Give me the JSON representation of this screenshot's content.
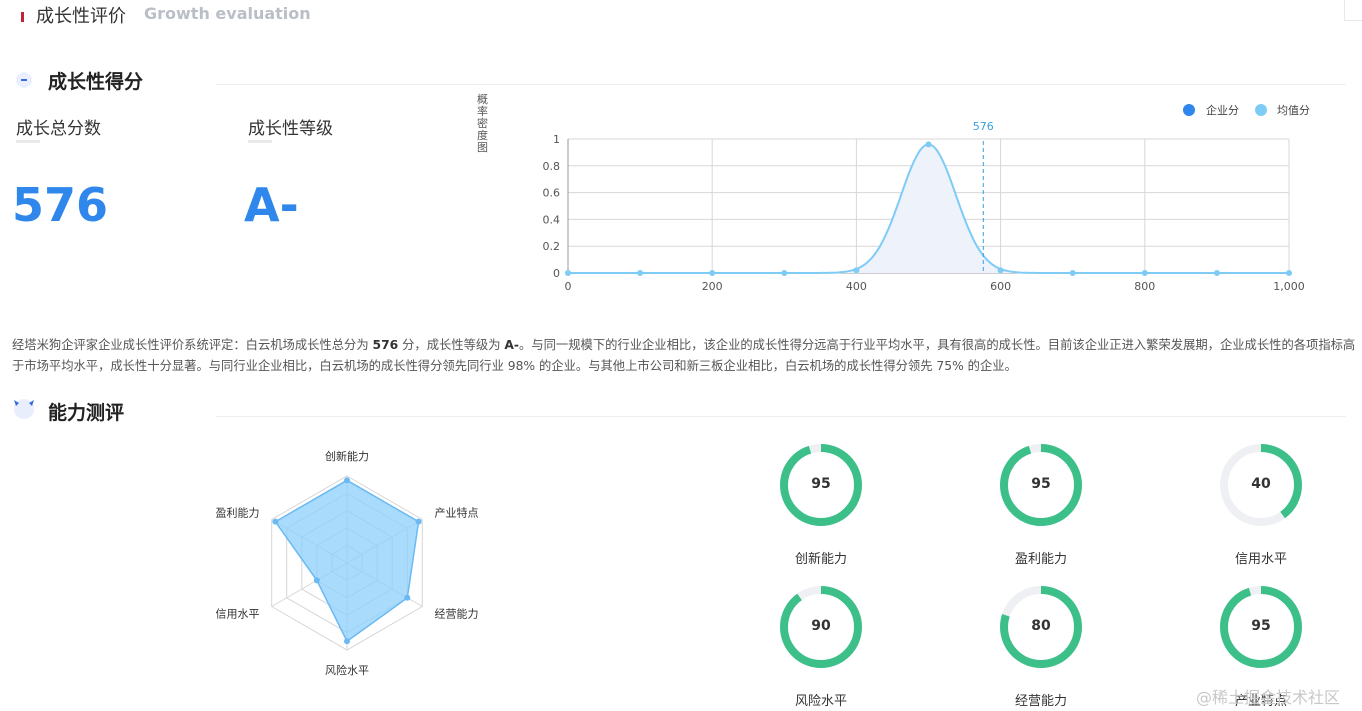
{
  "section": {
    "title": "成长性评价",
    "subtitle": "Growth evaluation"
  },
  "score_block": {
    "heading": "成长性得分",
    "total_label": "成长总分数",
    "total_value": "576",
    "grade_label": "成长性等级",
    "grade_value": "A-"
  },
  "distribution_chart": {
    "y_title": "概率密度图",
    "legend": [
      {
        "name": "企业分",
        "color": "#2f86eb"
      },
      {
        "name": "均值分",
        "color": "#7ecbf6"
      }
    ],
    "marker_label": "576",
    "chart_data": {
      "type": "line",
      "x_ticks": [
        "0",
        "200",
        "400",
        "600",
        "800",
        "1,000"
      ],
      "y_ticks": [
        "0",
        "0.2",
        "0.4",
        "0.6",
        "0.8",
        "1"
      ],
      "xlim": [
        0,
        1000
      ],
      "ylim": [
        0,
        1
      ],
      "series": [
        {
          "name": "均值分",
          "points": [
            [
              0,
              0
            ],
            [
              100,
              0
            ],
            [
              200,
              0
            ],
            [
              300,
              0
            ],
            [
              400,
              0.02
            ],
            [
              500,
              0.96
            ],
            [
              600,
              0.02
            ],
            [
              700,
              0
            ],
            [
              800,
              0
            ],
            [
              900,
              0
            ],
            [
              1000,
              0
            ]
          ]
        }
      ],
      "marker_x": 576
    }
  },
  "summary": {
    "p1": "经塔米狗企评家企业成长性评价系统评定：白云机场成长性总分为 ",
    "score": "576",
    "p2": " 分，成长性等级为 ",
    "grade": "A-",
    "p3": "。与同一规模下的行业企业相比，该企业的成长性得分远高于行业平均水平，具有很高的成长性。目前该企业正进入繁荣发展期，企业成长性的各项指标高于市场平均水平，成长性十分显著。与同行业企业相比，白云机场的成长性得分领先同行业 98% 的企业。与其他上市公司和新三板企业相比，白云机场的成长性得分领先 75% 的企业。"
  },
  "ability": {
    "heading": "能力测评",
    "radar": {
      "chart_data": {
        "type": "radar",
        "axes": [
          "创新能力",
          "产业特点",
          "经营能力",
          "风险水平",
          "信用水平",
          "盈利能力"
        ],
        "values": [
          95,
          95,
          80,
          90,
          40,
          95
        ],
        "max": 100
      }
    },
    "donuts": [
      {
        "label": "创新能力",
        "value": "95"
      },
      {
        "label": "盈利能力",
        "value": "95"
      },
      {
        "label": "信用水平",
        "value": "40"
      },
      {
        "label": "风险水平",
        "value": "90"
      },
      {
        "label": "经营能力",
        "value": "80"
      },
      {
        "label": "产业特点",
        "value": "95"
      }
    ],
    "colors": {
      "ring": "#3dbf8a",
      "track": "#eef0f3",
      "radar_fill": "#8cd0fb",
      "radar_line": "#6bb9f2"
    }
  },
  "watermark": "@稀土掘金技术社区"
}
